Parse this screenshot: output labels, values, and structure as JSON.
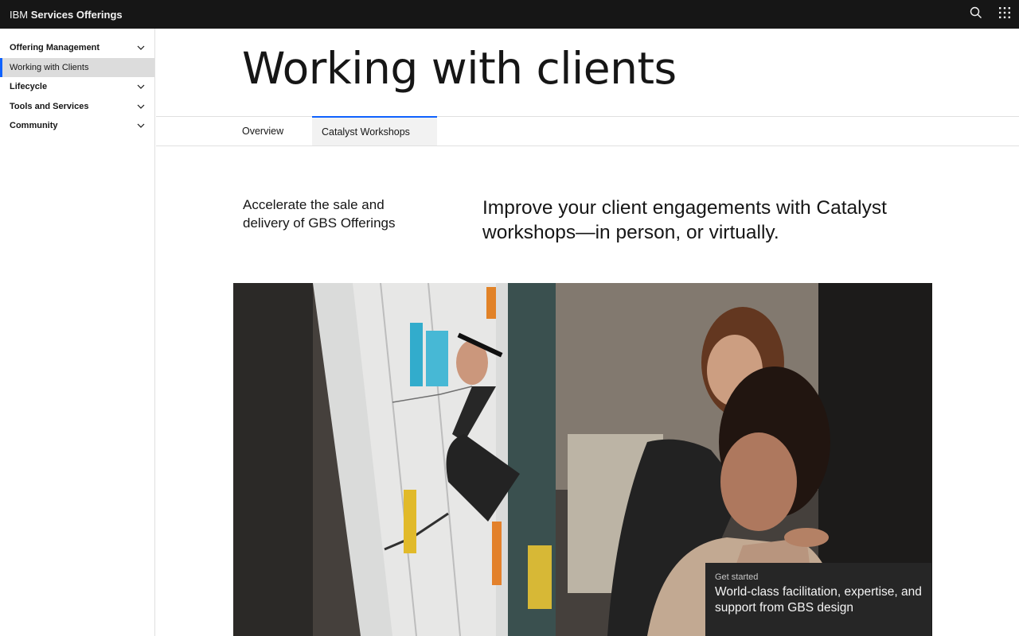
{
  "header": {
    "brand_prefix": "IBM",
    "brand_name": "Services Offerings",
    "search_icon": "search-icon",
    "switcher_icon": "app-switcher-icon"
  },
  "sidebar": {
    "items": [
      {
        "label": "Offering Management",
        "expandable": true
      },
      {
        "label": "Working with Clients",
        "expandable": false,
        "active": true
      },
      {
        "label": "Lifecycle",
        "expandable": true
      },
      {
        "label": "Tools and Services",
        "expandable": true
      },
      {
        "label": "Community",
        "expandable": true
      }
    ]
  },
  "main": {
    "title": "Working with clients",
    "tabs": [
      {
        "label": "Overview",
        "selected": false
      },
      {
        "label": "Catalyst Workshops",
        "selected": true
      }
    ],
    "lead": "Accelerate the sale and delivery of GBS Offerings",
    "headline": "Improve your client engagements with Catalyst workshops—in person, or virtually.",
    "cta": {
      "eyebrow": "Get started",
      "text": "World-class facilitation, expertise, and support from GBS design"
    }
  },
  "colors": {
    "header_bg": "#161616",
    "accent": "#0f62fe",
    "active_nav_bg": "#dcdcdc",
    "selected_tab_bg": "#f2f2f2",
    "cta_bg": "#262626"
  }
}
